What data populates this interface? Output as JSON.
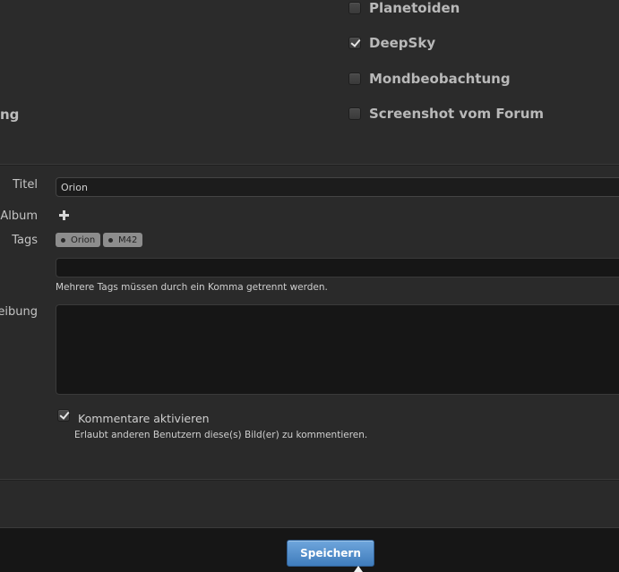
{
  "categories": {
    "cut_off_label": "ng",
    "items": [
      {
        "label": "Planetoiden",
        "checked": false
      },
      {
        "label": "DeepSky",
        "checked": true
      },
      {
        "label": "Mondbeobachtung",
        "checked": false
      },
      {
        "label": "Screenshot vom Forum",
        "checked": false
      }
    ]
  },
  "form": {
    "title_label": "Titel",
    "title_value": "Orion",
    "album_label": "Album",
    "tags_label": "Tags",
    "tags": [
      "Orion",
      "M42"
    ],
    "tag_input_value": "",
    "tags_hint": "Mehrere Tags müssen durch ein Komma getrennt werden.",
    "description_label": "reibung",
    "comments_label": "Kommentare aktivieren",
    "comments_checked": true,
    "comments_hint": "Erlaubt anderen Benutzern diese(s) Bild(er) zu kommentieren."
  },
  "footer": {
    "save_label": "Speichern"
  }
}
